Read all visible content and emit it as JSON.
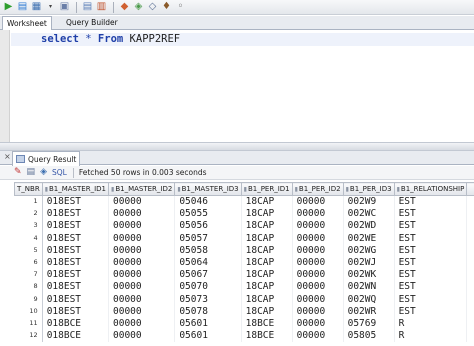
{
  "toolbar": {
    "buttons": [
      "run-statement-icon",
      "run-script-icon",
      "commit-icon",
      "rollback-icon",
      "autotrace-icon",
      "explain-plan-icon",
      "sql-tuning-icon",
      "clear-icon",
      "history-icon",
      "format-icon",
      "tool-icon",
      "more-icon",
      "extra-icon"
    ]
  },
  "worksheet_tabs": {
    "worksheet": "Worksheet",
    "query_builder": "Query Builder"
  },
  "editor": {
    "sql_keyword_select": "select",
    "sql_star": "*",
    "sql_keyword_from": "From",
    "sql_table": "KAPP2REF"
  },
  "result": {
    "tab_label": "Query Result",
    "close_symbol": "×",
    "sql_label": "SQL",
    "status": "Fetched 50 rows in 0.003 seconds"
  },
  "grid": {
    "columns": [
      "T_NBR",
      "B1_MASTER_ID1",
      "B1_MASTER_ID2",
      "B1_MASTER_ID3",
      "B1_PER_ID1",
      "B1_PER_ID2",
      "B1_PER_ID3",
      "B1_RELATIONSHIP"
    ],
    "rows": [
      [
        "1",
        "018EST",
        "00000",
        "05046",
        "18CAP",
        "00000",
        "002W9",
        "EST"
      ],
      [
        "2",
        "018EST",
        "00000",
        "05055",
        "18CAP",
        "00000",
        "002WC",
        "EST"
      ],
      [
        "3",
        "018EST",
        "00000",
        "05056",
        "18CAP",
        "00000",
        "002WD",
        "EST"
      ],
      [
        "4",
        "018EST",
        "00000",
        "05057",
        "18CAP",
        "00000",
        "002WE",
        "EST"
      ],
      [
        "5",
        "018EST",
        "00000",
        "05058",
        "18CAP",
        "00000",
        "002WG",
        "EST"
      ],
      [
        "6",
        "018EST",
        "00000",
        "05064",
        "18CAP",
        "00000",
        "002WJ",
        "EST"
      ],
      [
        "7",
        "018EST",
        "00000",
        "05067",
        "18CAP",
        "00000",
        "002WK",
        "EST"
      ],
      [
        "8",
        "018EST",
        "00000",
        "05070",
        "18CAP",
        "00000",
        "002WN",
        "EST"
      ],
      [
        "9",
        "018EST",
        "00000",
        "05073",
        "18CAP",
        "00000",
        "002WQ",
        "EST"
      ],
      [
        "10",
        "018EST",
        "00000",
        "05078",
        "18CAP",
        "00000",
        "002WR",
        "EST"
      ],
      [
        "11",
        "018BCE",
        "00000",
        "05601",
        "18BCE",
        "00000",
        "05769",
        "R"
      ],
      [
        "12",
        "018BCE",
        "00000",
        "05601",
        "18BCE",
        "00000",
        "05805",
        "R"
      ]
    ]
  }
}
